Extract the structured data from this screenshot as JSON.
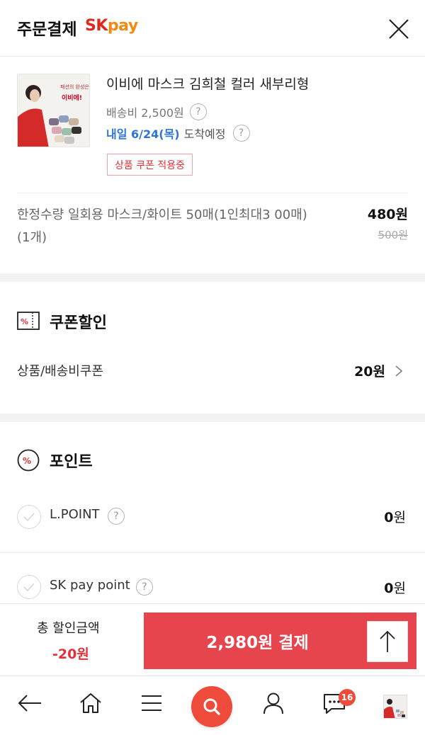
{
  "header": {
    "title": "주문결제",
    "brand_sk": "SK",
    "brand_pay": "pay"
  },
  "product": {
    "thumb_text_top": "패션의 완성은",
    "thumb_text_brand": "이비에!",
    "name": "이비에 마스크 김희철 컬러 새부리형",
    "shipping_fee": "배송비 2,500원",
    "arrival_highlight": "내일 6/24(목)",
    "arrival_suffix": "도착예정",
    "coupon_tag": "상품 쿠폰 적용중",
    "option_name": "한정수량 일회용 마스크/화이트 50매(1인최대3 00매) (1개)",
    "price": "480원",
    "original_price": "500원"
  },
  "coupon": {
    "title": "쿠폰할인",
    "row_label": "상품/배송비쿠폰",
    "row_value": "20원"
  },
  "point": {
    "title": "포인트",
    "rows": [
      {
        "label": "L.POINT",
        "value_num": "0",
        "value_unit": "원"
      },
      {
        "label": "SK pay point",
        "value_num": "0",
        "value_unit": "원"
      }
    ]
  },
  "paybar": {
    "discount_label": "총 할인금액",
    "discount_value": "-20원",
    "pay_label": "2,980원 결제"
  },
  "bottom_nav": {
    "chat_badge": "16"
  },
  "colors": {
    "brand_red": "#e0281f",
    "pay_orange": "#f08a12",
    "pay_button": "#e6454d",
    "discount_red": "#e0323a",
    "link_blue": "#2d74d6"
  }
}
